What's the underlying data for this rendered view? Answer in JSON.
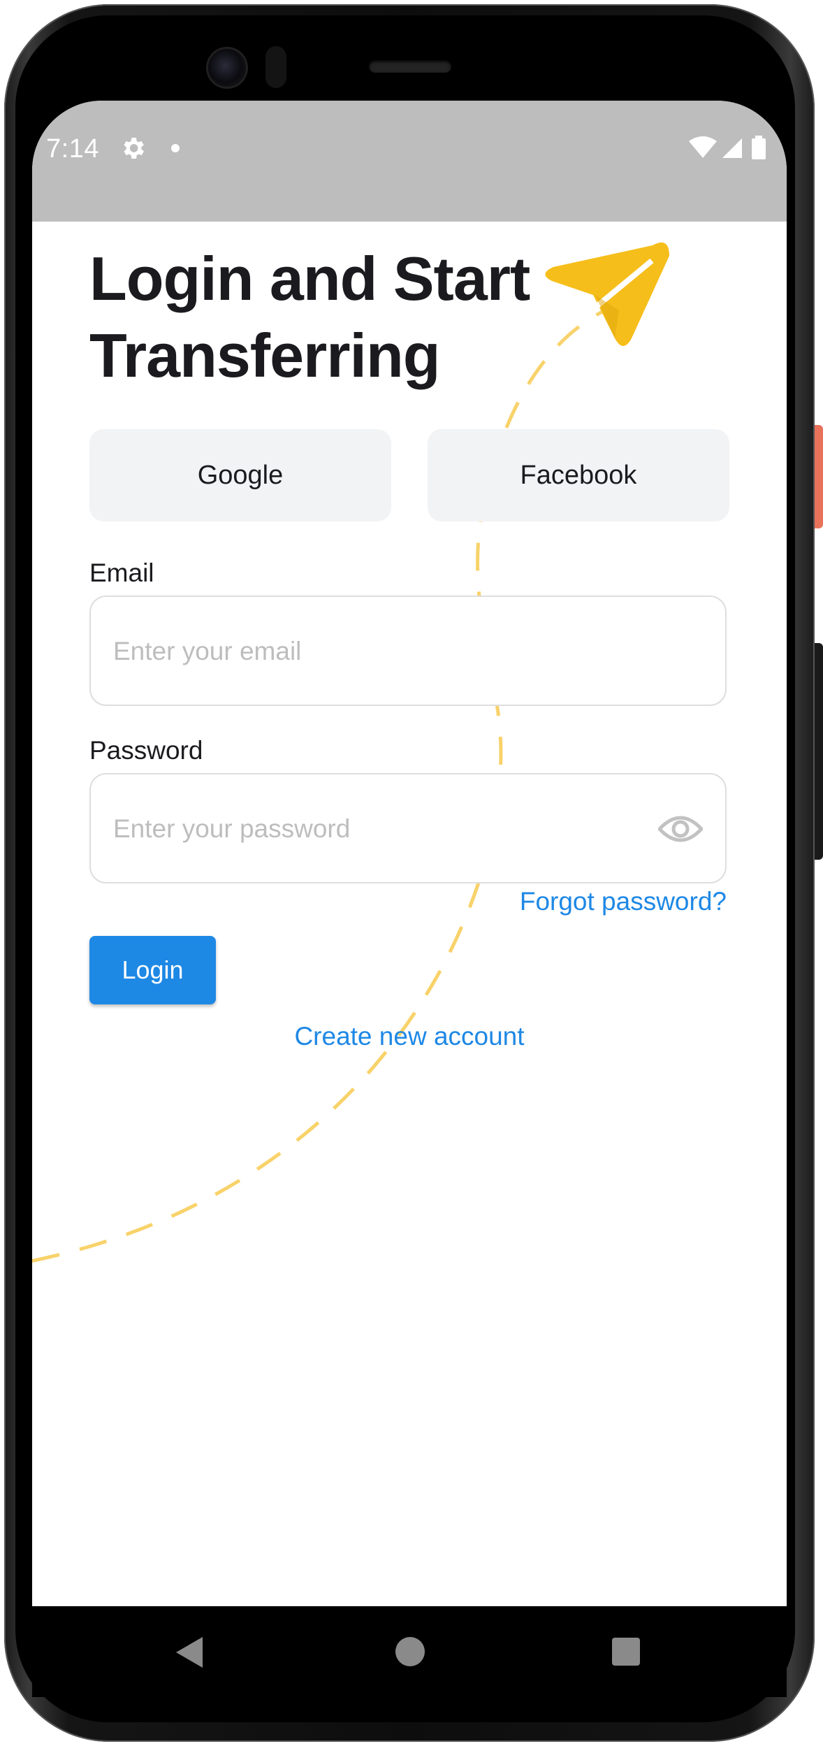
{
  "status_bar": {
    "time": "7:14",
    "icons": [
      "settings-icon",
      "notification-dot-icon",
      "wifi-icon",
      "signal-icon",
      "battery-icon"
    ],
    "background": "#bdbdbd"
  },
  "page": {
    "title": "Login and Start Transferring"
  },
  "social": {
    "google_label": "Google",
    "facebook_label": "Facebook"
  },
  "form": {
    "email_label": "Email",
    "email_placeholder": "Enter your email",
    "email_value": "",
    "password_label": "Password",
    "password_placeholder": "Enter your password",
    "password_value": "",
    "forgot_label": "Forgot password?",
    "login_label": "Login",
    "create_label": "Create new account"
  },
  "nav": {
    "icons": [
      "back-icon",
      "home-icon",
      "recents-icon"
    ]
  },
  "colors": {
    "accent": "#1e88e5",
    "decoration": "#f6be1a",
    "button_bg": "#f2f3f5",
    "text": "#1b1b1f"
  }
}
